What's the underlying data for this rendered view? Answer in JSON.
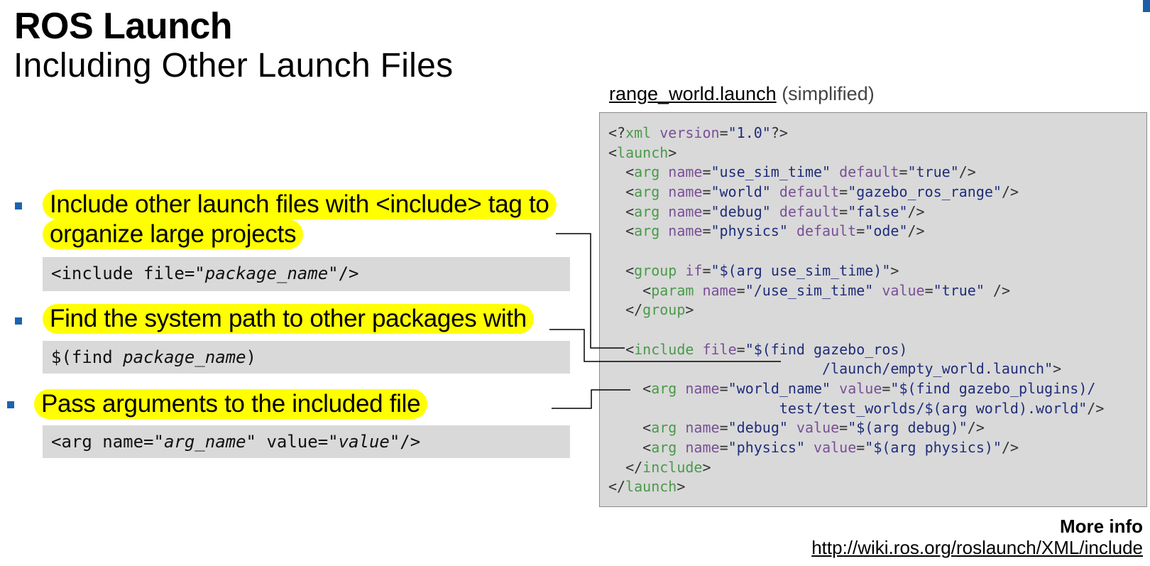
{
  "header": {
    "title": "ROS Launch",
    "subtitle": "Including Other Launch Files"
  },
  "accent_color": "#1a64b0",
  "highlight_color": "#ffff00",
  "bullets": [
    {
      "line1": "Include other launch files with <include> tag to",
      "line2": "organize large projects",
      "code": {
        "pre": "<include file=\"",
        "italic": "package_name",
        "post": "\"/>"
      }
    },
    {
      "line1": "Find the system path to other packages with",
      "code": {
        "pre": "$(find ",
        "italic": "package_name",
        "post": ")"
      }
    },
    {
      "line1": "Pass arguments to the included file",
      "code": {
        "pre": "<arg name=\"",
        "italic": "arg_name",
        "mid": "\" value=\"",
        "italic2": "value",
        "post": "\"/>"
      }
    }
  ],
  "example": {
    "file_name": "range_world.launch",
    "note": "(simplified)",
    "lines": [
      [
        [
          "p",
          "<?"
        ],
        [
          "t",
          "xml"
        ],
        [
          "p",
          " "
        ],
        [
          "a",
          "version"
        ],
        [
          "p",
          "="
        ],
        [
          "s",
          "\"1.0\""
        ],
        [
          "p",
          "?>"
        ]
      ],
      [
        [
          "p",
          "<"
        ],
        [
          "t",
          "launch"
        ],
        [
          "p",
          ">"
        ]
      ],
      [
        [
          "p",
          "  <"
        ],
        [
          "t",
          "arg"
        ],
        [
          "p",
          " "
        ],
        [
          "a",
          "name"
        ],
        [
          "p",
          "="
        ],
        [
          "s",
          "\"use_sim_time\""
        ],
        [
          "p",
          " "
        ],
        [
          "a",
          "default"
        ],
        [
          "p",
          "="
        ],
        [
          "s",
          "\"true\""
        ],
        [
          "p",
          "/>"
        ]
      ],
      [
        [
          "p",
          "  <"
        ],
        [
          "t",
          "arg"
        ],
        [
          "p",
          " "
        ],
        [
          "a",
          "name"
        ],
        [
          "p",
          "="
        ],
        [
          "s",
          "\"world\""
        ],
        [
          "p",
          " "
        ],
        [
          "a",
          "default"
        ],
        [
          "p",
          "="
        ],
        [
          "s",
          "\"gazebo_ros_range\""
        ],
        [
          "p",
          "/>"
        ]
      ],
      [
        [
          "p",
          "  <"
        ],
        [
          "t",
          "arg"
        ],
        [
          "p",
          " "
        ],
        [
          "a",
          "name"
        ],
        [
          "p",
          "="
        ],
        [
          "s",
          "\"debug\""
        ],
        [
          "p",
          " "
        ],
        [
          "a",
          "default"
        ],
        [
          "p",
          "="
        ],
        [
          "s",
          "\"false\""
        ],
        [
          "p",
          "/>"
        ]
      ],
      [
        [
          "p",
          "  <"
        ],
        [
          "t",
          "arg"
        ],
        [
          "p",
          " "
        ],
        [
          "a",
          "name"
        ],
        [
          "p",
          "="
        ],
        [
          "s",
          "\"physics\""
        ],
        [
          "p",
          " "
        ],
        [
          "a",
          "default"
        ],
        [
          "p",
          "="
        ],
        [
          "s",
          "\"ode\""
        ],
        [
          "p",
          "/>"
        ]
      ],
      [],
      [
        [
          "p",
          "  <"
        ],
        [
          "t",
          "group"
        ],
        [
          "p",
          " "
        ],
        [
          "a",
          "if"
        ],
        [
          "p",
          "="
        ],
        [
          "s",
          "\"$(arg use_sim_time)\""
        ],
        [
          "p",
          ">"
        ]
      ],
      [
        [
          "p",
          "    <"
        ],
        [
          "t",
          "param"
        ],
        [
          "p",
          " "
        ],
        [
          "a",
          "name"
        ],
        [
          "p",
          "="
        ],
        [
          "s",
          "\"/use_sim_time\""
        ],
        [
          "p",
          " "
        ],
        [
          "a",
          "value"
        ],
        [
          "p",
          "="
        ],
        [
          "s",
          "\"true\""
        ],
        [
          "p",
          " />"
        ]
      ],
      [
        [
          "p",
          "  </"
        ],
        [
          "t",
          "group"
        ],
        [
          "p",
          ">"
        ]
      ],
      [],
      [
        [
          "p",
          "  <"
        ],
        [
          "t",
          "include"
        ],
        [
          "p",
          " "
        ],
        [
          "a",
          "file"
        ],
        [
          "p",
          "="
        ],
        [
          "s",
          "\"$(find gazebo_ros)"
        ]
      ],
      [
        [
          "s",
          "                         /launch/empty_world.launch\""
        ],
        [
          "p",
          ">"
        ]
      ],
      [
        [
          "p",
          "    <"
        ],
        [
          "t",
          "arg"
        ],
        [
          "p",
          " "
        ],
        [
          "a",
          "name"
        ],
        [
          "p",
          "="
        ],
        [
          "s",
          "\"world_name\""
        ],
        [
          "p",
          " "
        ],
        [
          "a",
          "value"
        ],
        [
          "p",
          "="
        ],
        [
          "s",
          "\"$(find gazebo_plugins)/"
        ]
      ],
      [
        [
          "s",
          "                    test/test_worlds/$(arg world).world\""
        ],
        [
          "p",
          "/>"
        ]
      ],
      [
        [
          "p",
          "    <"
        ],
        [
          "t",
          "arg"
        ],
        [
          "p",
          " "
        ],
        [
          "a",
          "name"
        ],
        [
          "p",
          "="
        ],
        [
          "s",
          "\"debug\""
        ],
        [
          "p",
          " "
        ],
        [
          "a",
          "value"
        ],
        [
          "p",
          "="
        ],
        [
          "s",
          "\"$(arg debug)\""
        ],
        [
          "p",
          "/>"
        ]
      ],
      [
        [
          "p",
          "    <"
        ],
        [
          "t",
          "arg"
        ],
        [
          "p",
          " "
        ],
        [
          "a",
          "name"
        ],
        [
          "p",
          "="
        ],
        [
          "s",
          "\"physics\""
        ],
        [
          "p",
          " "
        ],
        [
          "a",
          "value"
        ],
        [
          "p",
          "="
        ],
        [
          "s",
          "\"$(arg physics)\""
        ],
        [
          "p",
          "/>"
        ]
      ],
      [
        [
          "p",
          "  </"
        ],
        [
          "t",
          "include"
        ],
        [
          "p",
          ">"
        ]
      ],
      [
        [
          "p",
          "</"
        ],
        [
          "t",
          "launch"
        ],
        [
          "p",
          ">"
        ]
      ]
    ]
  },
  "footer": {
    "more_info_label": "More info",
    "link": "http://wiki.ros.org/roslaunch/XML/include"
  }
}
